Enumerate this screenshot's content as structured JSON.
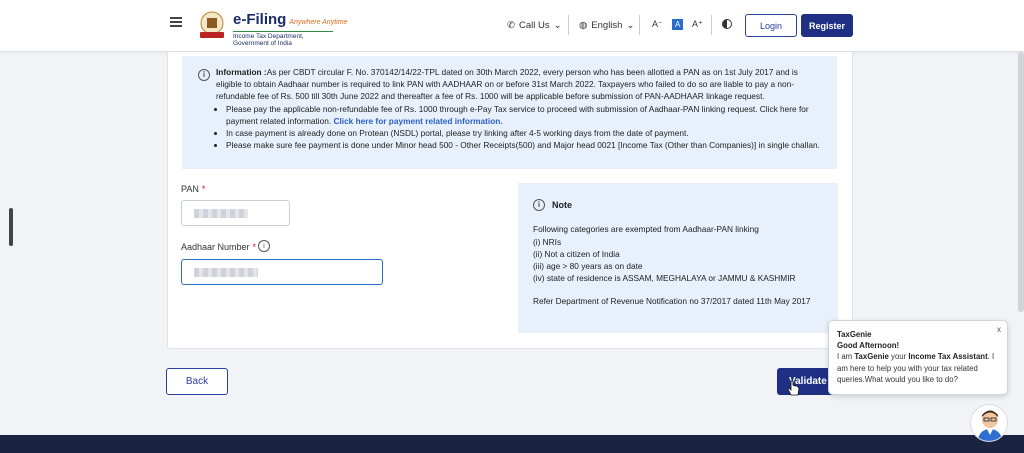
{
  "header": {
    "logo_main": "e-Filing",
    "logo_tagline": "Anywhere Anytime",
    "logo_sub": "Income Tax Department, Government of India",
    "call_us": "Call Us",
    "language": "English",
    "font_decrease": "A⁻",
    "font_normal": "A",
    "font_increase": "A⁺",
    "login": "Login",
    "register": "Register"
  },
  "info": {
    "heading": "Information :",
    "text": "As per CBDT circular F. No. 370142/14/22-TPL dated on 30th March 2022, every person who has been allotted a PAN as on 1st July 2017 and is eligible to obtain Aadhaar number is required to link PAN with AADHAAR on or before 31st March 2022. Taxpayers who failed to do so are liable to pay a non-refundable fee of Rs. 500 till 30th June 2022 and thereafter a fee of Rs. 1000 will be applicable before submission of PAN-AADHAAR linkage request.",
    "bullet1": "Please pay the applicable non-refundable fee of Rs. 1000 through e-Pay Tax service to proceed with submission of Aadhaar-PAN linking request. Click here for payment related information.",
    "bullet1_link": "Click here for payment related information.",
    "bullet2": "In case payment is already done on Protean (NSDL) portal, please try linking after 4-5 working days from the date of payment.",
    "bullet3": "Please make sure fee payment is done under Minor head 500 - Other Receipts(500) and Major head 0021 [Income Tax (Other than Companies)] in single challan."
  },
  "form": {
    "pan_label": "PAN",
    "aadhaar_label": "Aadhaar Number",
    "required_mark": "*"
  },
  "note": {
    "title": "Note",
    "line0": "Following categories are exempted from Aadhaar-PAN linking",
    "line1": "(i) NRIs",
    "line2": "(ii) Not a citizen of India",
    "line3": "(iii) age > 80 years as on date",
    "line4": "(iv) state of residence is ASSAM, MEGHALAYA or JAMMU & KASHMIR",
    "ref": "Refer Department of Revenue Notification no 37/2017 dated 11th May 2017"
  },
  "buttons": {
    "back": "Back",
    "validate": "Validate"
  },
  "chat": {
    "name": "TaxGenie",
    "greeting": "Good Afternoon!",
    "msg_pre": "I am ",
    "msg_bold1": "TaxGenie",
    "msg_mid": " your ",
    "msg_bold2": "Income Tax Assistant",
    "msg_post": ". I am here to help you with your tax related queries.What would you like to do?",
    "close": "x"
  }
}
